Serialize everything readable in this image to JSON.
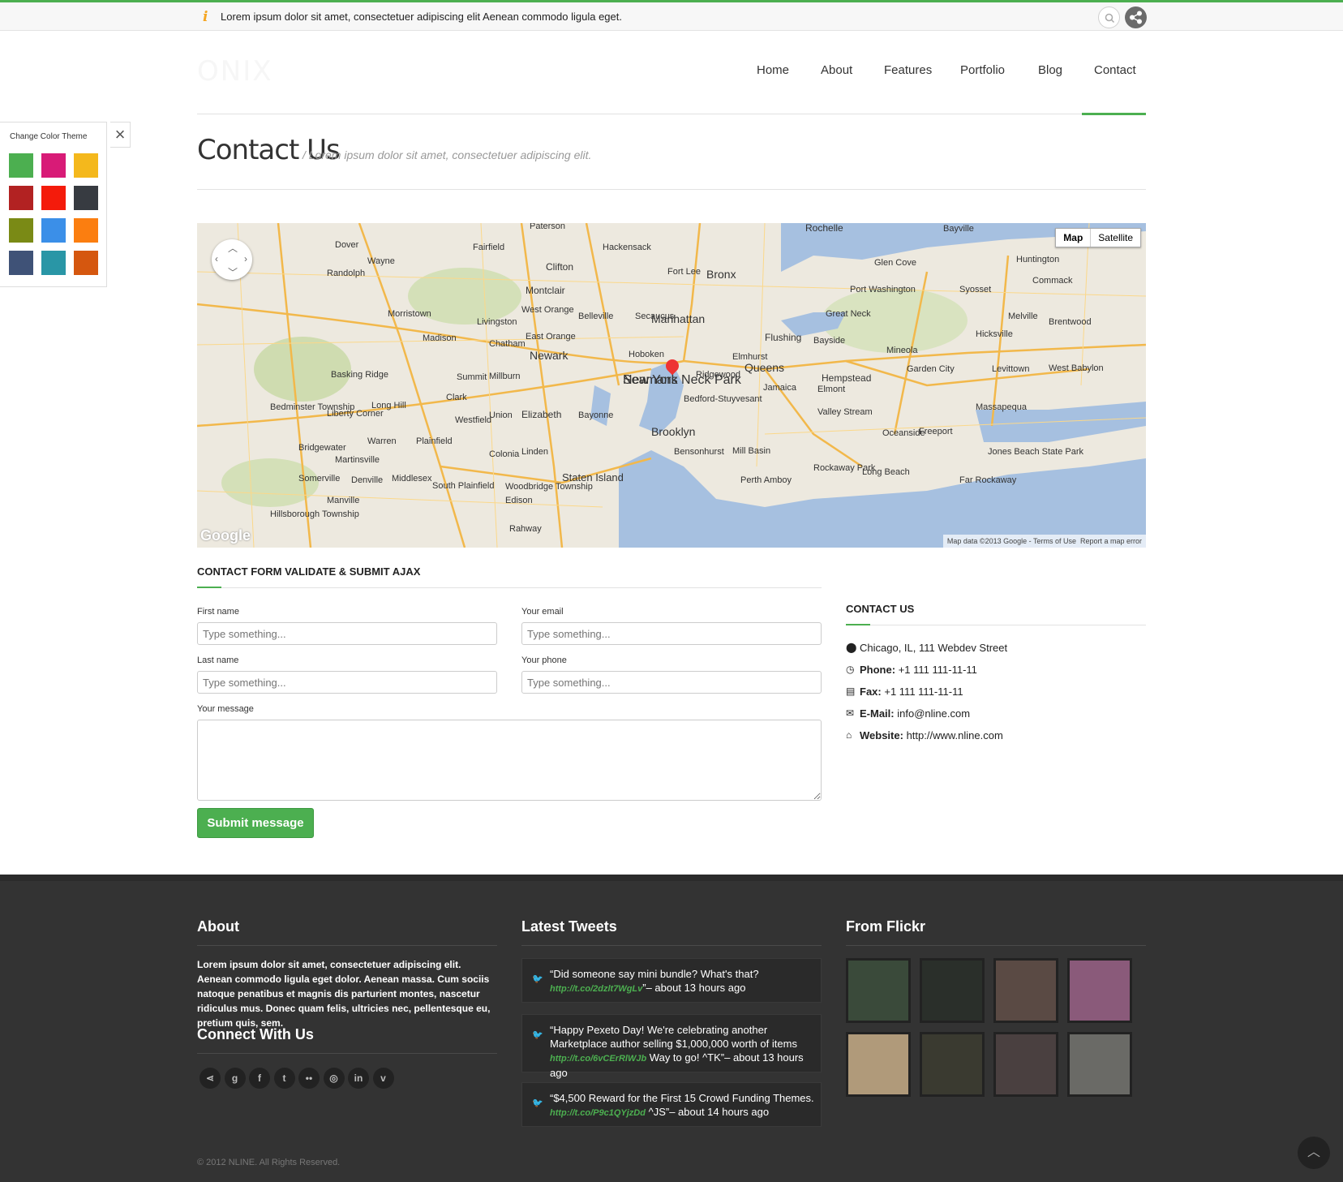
{
  "topbar": {
    "info_text": "Lorem ipsum dolor sit amet, consectetuer adipiscing elit Aenean commodo ligula eget."
  },
  "logo": "ONIX",
  "nav": {
    "items": [
      {
        "label": "Home"
      },
      {
        "label": "About"
      },
      {
        "label": "Features"
      },
      {
        "label": "Portfolio"
      },
      {
        "label": "Blog"
      },
      {
        "label": "Contact"
      }
    ],
    "active": "Contact"
  },
  "theme_switcher": {
    "title": "Change Color Theme",
    "colors": [
      "#4caf50",
      "#d81b77",
      "#f4b81c",
      "#b22222",
      "#f41b0b",
      "#373b41",
      "#7a8a15",
      "#3b8fe8",
      "#fb7e10",
      "#3f5277",
      "#2996a6",
      "#d5570f"
    ]
  },
  "page": {
    "title": "Contact Us",
    "subtitle": "Lorem ipsum dolor sit amet, consectetuer adipiscing elit."
  },
  "map": {
    "type_map": "Map",
    "type_satellite": "Satellite",
    "footer_text": "Map data ©2013 Google - Terms of Use",
    "report": "Report a map error",
    "brand": "Google",
    "labels": [
      "New York",
      "Manhattan",
      "Brooklyn",
      "Queens",
      "Newark",
      "Bronx",
      "Staten Island",
      "Hempstead",
      "Flushing",
      "Elizabeth",
      "Hoboken",
      "Jamaica",
      "Montclair",
      "Clifton",
      "Paterson",
      "Hackensack",
      "Levittown",
      "Massapequa",
      "Plainfield",
      "Summit",
      "Union",
      "Bayonne",
      "Linden",
      "Edison",
      "Woodbridge Township",
      "Long Beach",
      "Freeport",
      "Glen Cove",
      "Huntington",
      "Syosset",
      "Rochelle",
      "Westfield",
      "Morristown",
      "Bridgewater",
      "Somerville",
      "Denville",
      "Dover",
      "Randolph",
      "Madison",
      "Livingston",
      "East Orange",
      "West Orange",
      "Belleville",
      "Secaucus",
      "Fort Lee",
      "Bayside",
      "Mineola",
      "Garden City",
      "Elmont",
      "Valley Stream",
      "Oceanside",
      "Ridgewood",
      "Elmhurst",
      "Bedford-Stuyvesant",
      "Bensonhurst",
      "Mill Basin",
      "Hicksville",
      "Melville",
      "Commack",
      "Brentwood",
      "West Babylon",
      "Great Neck",
      "Port Washington",
      "Bayville",
      "Fairfield",
      "Wayne",
      "Chatham",
      "Millburn",
      "Basking Ridge",
      "Bedminster Township",
      "Liberty Corner",
      "Long Hill",
      "Warren",
      "Martinsville",
      "Middlesex",
      "Manville",
      "Hillsborough Township",
      "South Plainfield",
      "Colonia",
      "Clark",
      "Rahway",
      "Perth Amboy",
      "Rockaway Park",
      "Far Rockaway",
      "Jones Beach State Park",
      "Seamans Neck Park"
    ]
  },
  "contact_form": {
    "title": "Contact form validate & submit ajax",
    "first_name_label": "First name",
    "email_label": "Your email",
    "last_name_label": "Last name",
    "phone_label": "Your phone",
    "message_label": "Your message",
    "placeholder": "Type something...",
    "submit_label": "Submit message"
  },
  "contact_info": {
    "title": "Contact us",
    "address": "Chicago, IL, 111 Webdev Street",
    "phone_label": "Phone:",
    "phone": "+1 111 111-11-11",
    "fax_label": "Fax:",
    "fax": "+1 111 111-11-11",
    "email_label": "E-Mail:",
    "email": "info@nline.com",
    "website_label": "Website:",
    "website": "http://www.nline.com"
  },
  "footer": {
    "about_title": "About",
    "about_text": "Lorem ipsum dolor sit amet, consectetuer adipiscing elit. Aenean commodo ligula eget dolor. Aenean massa. Cum sociis natoque penatibus et magnis dis parturient montes, nascetur ridiculus mus. Donec quam felis, ultricies nec, pellentesque eu, pretium quis, sem.",
    "connect_title": "Connect With Us",
    "social_icons": [
      "share-icon",
      "google-plus-icon",
      "facebook-icon",
      "twitter-icon",
      "flickr-icon",
      "dribbble-icon",
      "linkedin-icon",
      "vimeo-icon"
    ],
    "tweets_title": "Latest Tweets",
    "tweets": [
      {
        "text": "“Did someone say mini bundle? What's that?",
        "link": "http://t.co/2dzlt7WgLv",
        "after": "”– about 13 hours ago"
      },
      {
        "text": "“Happy Pexeto Day! We're celebrating another Marketplace author selling $1,000,000 worth of items",
        "link": "http://t.co/6vCErRlWJb",
        "after": "Way to go! ^TK”– about 13 hours ago"
      },
      {
        "text": "“$4,500 Reward for the First 15 Crowd Funding Themes.",
        "link": "http://t.co/P9c1QYjzDd",
        "after": "^JS”– about 14 hours ago"
      }
    ],
    "flickr_title": "From Flickr",
    "copyright": "© 2012 NLINE. All Rights Reserved."
  }
}
